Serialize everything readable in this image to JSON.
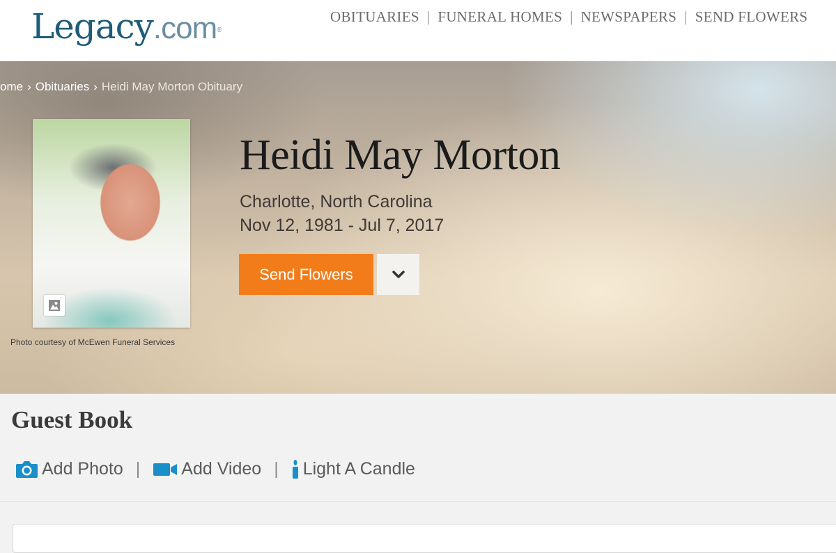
{
  "header": {
    "logo_brand": "Legacy",
    "logo_tld": ".com",
    "logo_reg": "®",
    "nav": [
      "OBITUARIES",
      "FUNERAL HOMES",
      "NEWSPAPERS",
      "SEND FLOWERS"
    ],
    "nav_sep": "|"
  },
  "breadcrumb": {
    "items": [
      "ome",
      "Obituaries",
      "Heidi May Morton Obituary"
    ],
    "separator": "›"
  },
  "person": {
    "name": "Heidi May Morton",
    "location": "Charlotte, North Carolina",
    "dates": "Nov 12, 1981 - Jul 7, 2017",
    "photo_credit": "Photo courtesy of McEwen Funeral Services",
    "photo_icon": "image-gallery-icon"
  },
  "actions": {
    "send_flowers": "Send Flowers",
    "dropdown_icon": "chevron-down-icon"
  },
  "guestbook": {
    "title": "Guest Book",
    "add_photo": "Add Photo",
    "add_video": "Add Video",
    "light_candle": "Light A Candle",
    "sep": "|"
  },
  "colors": {
    "brand": "#1e5c78",
    "accent": "#f37c1a",
    "icon_blue": "#1a8fc9"
  }
}
